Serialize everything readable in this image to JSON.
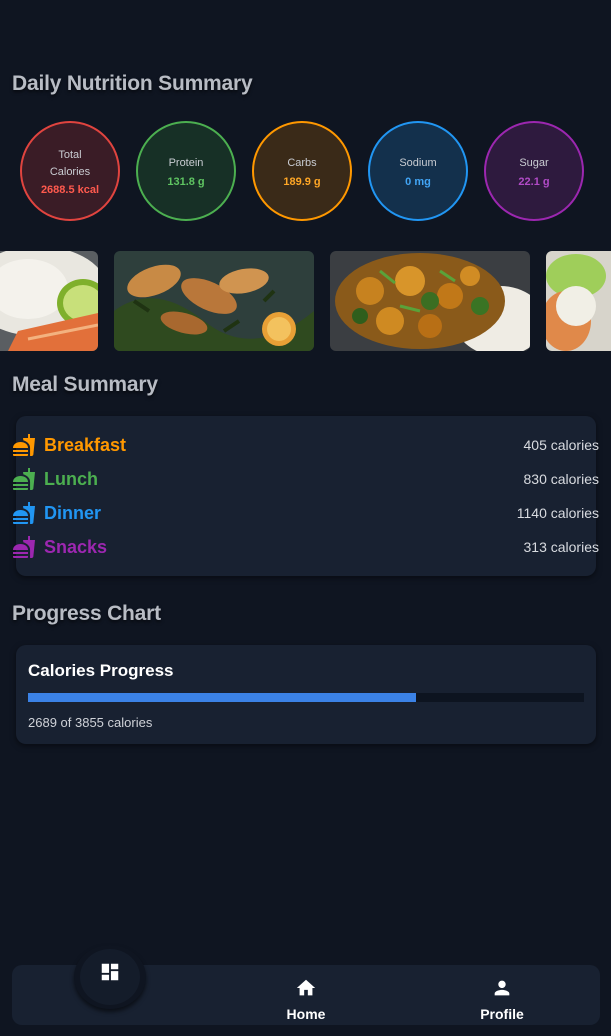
{
  "sections": {
    "nutrition_title": "Daily Nutrition Summary",
    "meals_title": "Meal Summary",
    "progress_title": "Progress Chart"
  },
  "nutrients": {
    "calories": {
      "label": "Total Calories",
      "value": "2688.5 kcal",
      "color": "#e0443f"
    },
    "protein": {
      "label": "Protein",
      "value": "131.8 g",
      "color": "#4caf50"
    },
    "carbs": {
      "label": "Carbs",
      "value": "189.9 g",
      "color": "#ff9800"
    },
    "sodium": {
      "label": "Sodium",
      "value": "0 mg",
      "color": "#2196f3"
    },
    "sugar": {
      "label": "Sugar",
      "value": "22.1 g",
      "color": "#9c27b0"
    }
  },
  "gallery": {
    "items": [
      {
        "name": "salmon-rice-lime"
      },
      {
        "name": "grilled-chicken-greens"
      },
      {
        "name": "chicken-broccoli-rice"
      },
      {
        "name": "salmon-salad"
      }
    ]
  },
  "meals": [
    {
      "name": "Breakfast",
      "calories": "405 calories",
      "color": "#ff9800",
      "icon": "fastfood-icon"
    },
    {
      "name": "Lunch",
      "calories": "830 calories",
      "color": "#4caf50",
      "icon": "fastfood-icon"
    },
    {
      "name": "Dinner",
      "calories": "1140 calories",
      "color": "#2196f3",
      "icon": "fastfood-icon"
    },
    {
      "name": "Snacks",
      "calories": "313 calories",
      "color": "#9c27b0",
      "icon": "fastfood-icon"
    }
  ],
  "progress": {
    "title": "Calories Progress",
    "text": "2689 of 3855 calories",
    "fraction": 0.6975,
    "color": "#3b82e6"
  },
  "nav": {
    "dashboard_icon": "dashboard-icon",
    "home_label": "Home",
    "home_icon": "home-icon",
    "profile_label": "Profile",
    "profile_icon": "person-icon"
  }
}
